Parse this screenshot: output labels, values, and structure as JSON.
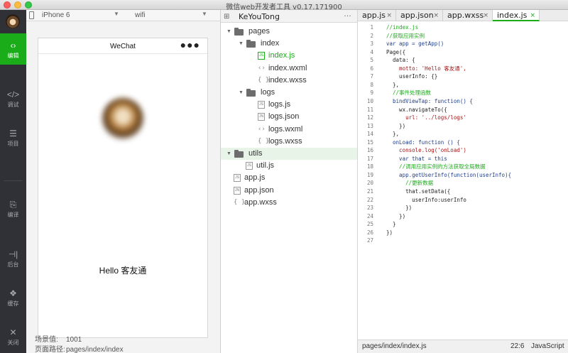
{
  "window": {
    "title": "微信web开发者工具 v0.17.171900"
  },
  "nav": {
    "items": [
      {
        "label": "编辑",
        "icon": "code-icon",
        "glyph": "‹›",
        "active": true
      },
      {
        "label": "调试",
        "icon": "debug-icon",
        "glyph": "</>",
        "active": false
      },
      {
        "label": "项目",
        "icon": "menu-icon",
        "glyph": "☰",
        "active": false
      },
      {
        "label": "编译",
        "icon": "compile-icon",
        "glyph": "⎘",
        "active": false
      },
      {
        "label": "后台",
        "icon": "background-icon",
        "glyph": "⊣|",
        "active": false
      },
      {
        "label": "缓存",
        "icon": "layers-icon",
        "glyph": "❖",
        "active": false
      },
      {
        "label": "关闭",
        "icon": "close-icon",
        "glyph": "✕",
        "active": false
      }
    ]
  },
  "simulator": {
    "device": "iPhone 6",
    "network": "wifi",
    "nav_title": "WeChat",
    "menu_glyph": "●●●",
    "greeting": "Hello 客友通",
    "scene_label": "场景值:",
    "scene_value": "1001",
    "path_label": "页面路径:",
    "path_value": "pages/index/index"
  },
  "tree": {
    "project": "KeYouTong",
    "more": "…",
    "rows": [
      {
        "name": "pages",
        "type": "folder",
        "depth": 0
      },
      {
        "name": "index",
        "type": "folder",
        "depth": 1
      },
      {
        "name": "index.js",
        "type": "js",
        "depth": 2,
        "selected": true
      },
      {
        "name": "index.wxml",
        "type": "wxml",
        "depth": 2
      },
      {
        "name": "index.wxss",
        "type": "wxss",
        "depth": 2
      },
      {
        "name": "logs",
        "type": "folder",
        "depth": 1
      },
      {
        "name": "logs.js",
        "type": "js",
        "depth": 2
      },
      {
        "name": "logs.json",
        "type": "json",
        "depth": 2
      },
      {
        "name": "logs.wxml",
        "type": "wxml",
        "depth": 2
      },
      {
        "name": "logs.wxss",
        "type": "wxss",
        "depth": 2
      },
      {
        "name": "utils",
        "type": "folder",
        "depth": 0,
        "highlight": true
      },
      {
        "name": "util.js",
        "type": "js",
        "depth": 1
      },
      {
        "name": "app.js",
        "type": "js",
        "depth": 0
      },
      {
        "name": "app.json",
        "type": "json",
        "depth": 0
      },
      {
        "name": "app.wxss",
        "type": "wxss",
        "depth": 0
      }
    ]
  },
  "editor": {
    "tabs": [
      {
        "label": "app.js",
        "active": false
      },
      {
        "label": "app.json",
        "active": false
      },
      {
        "label": "app.wxss",
        "active": false
      },
      {
        "label": "index.js",
        "active": true
      }
    ],
    "tab_close": "×",
    "lines": [
      "//index.js",
      "//获取应用实例",
      "var app = getApp()",
      "Page({",
      "  data: {",
      "    motto: 'Hello 客友通',",
      "    userInfo: {}",
      "  },",
      "  //事件处理函数",
      "  bindViewTap: function() {",
      "    wx.navigateTo({",
      "      url: '../logs/logs'",
      "    })",
      "  },",
      "  onLoad: function () {",
      "    console.log('onLoad')",
      "    var that = this",
      "    //调用应用实例的方法获取全局数据",
      "    app.getUserInfo(function(userInfo){",
      "      //更新数据",
      "      that.setData({",
      "        userInfo:userInfo",
      "      })",
      "    })",
      "  }",
      "})",
      ""
    ],
    "status": {
      "path": "pages/index/index.js",
      "position": "22:6",
      "language": "JavaScript"
    }
  }
}
